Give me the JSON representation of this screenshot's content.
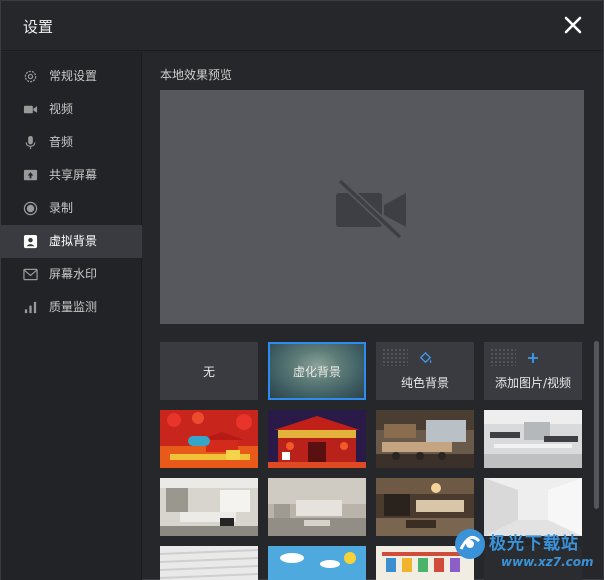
{
  "window": {
    "title": "设置"
  },
  "sidebar": {
    "items": [
      {
        "label": "常规设置",
        "icon": "gear-icon",
        "active": false
      },
      {
        "label": "视频",
        "icon": "video-camera-icon",
        "active": false
      },
      {
        "label": "音频",
        "icon": "microphone-icon",
        "active": false
      },
      {
        "label": "共享屏幕",
        "icon": "share-screen-icon",
        "active": false
      },
      {
        "label": "录制",
        "icon": "record-icon",
        "active": false
      },
      {
        "label": "虚拟背景",
        "icon": "virtual-background-icon",
        "active": true
      },
      {
        "label": "屏幕水印",
        "icon": "screen-watermark-icon",
        "active": false
      },
      {
        "label": "质量监测",
        "icon": "signal-bars-icon",
        "active": false
      }
    ]
  },
  "main": {
    "preview_title": "本地效果预览",
    "preview_icon": "video-off-icon",
    "options": [
      {
        "label": "无",
        "selected": false
      },
      {
        "label": "虚化背景",
        "selected": true
      },
      {
        "label": "纯色背景",
        "icon": "paint-bucket-icon",
        "selected": false
      },
      {
        "label": "添加图片/视频",
        "icon": "plus-icon",
        "selected": false
      }
    ],
    "thumbnails": [
      "spring-festival-lanterns",
      "spring-festival-gate",
      "office-room",
      "office-desks",
      "living-room-white",
      "living-room-sofa",
      "living-room-warm",
      "white-room",
      "white-ceiling",
      "sky-cartoon",
      "kids-room"
    ]
  },
  "watermark": {
    "text": "极光下载站",
    "url": "www.xz7.com"
  },
  "colors": {
    "accent": "#2d8cf0",
    "background": "#26272b",
    "sidebar_active": "#3a3b40"
  }
}
